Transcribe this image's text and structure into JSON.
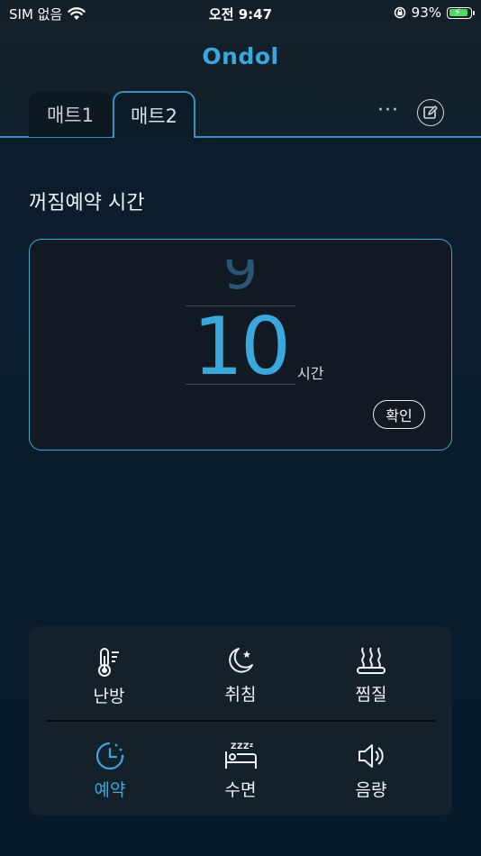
{
  "status_bar": {
    "carrier": "SIM 없음",
    "time": "오전 9:47",
    "battery": "93%"
  },
  "brand": {
    "logo_text": "Ondol",
    "accent_color": "#3aa7dd"
  },
  "tabs": [
    {
      "label": "매트1",
      "selected": false
    },
    {
      "label": "매트2",
      "selected": true
    }
  ],
  "header_actions": {
    "more_label": "···"
  },
  "timer": {
    "title": "꺼짐예약 시간",
    "previous_value": "9",
    "value": "10",
    "unit": "시간",
    "confirm_label": "확인"
  },
  "menu": {
    "items": [
      {
        "label": "난방",
        "icon": "thermometer-icon",
        "active": false
      },
      {
        "label": "취침",
        "icon": "moon-icon",
        "active": false
      },
      {
        "label": "찜질",
        "icon": "steam-icon",
        "active": false
      },
      {
        "label": "예약",
        "icon": "timer-icon",
        "active": true
      },
      {
        "label": "수면",
        "icon": "sleep-bed-icon",
        "active": false
      },
      {
        "label": "음량",
        "icon": "speaker-icon",
        "active": false
      }
    ]
  }
}
